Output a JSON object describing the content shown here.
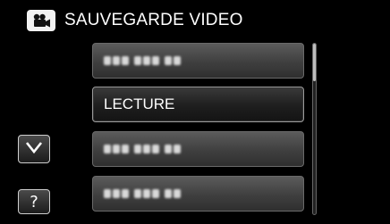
{
  "header": {
    "icon": "video-camera-icon",
    "title": "SAUVEGARDE VIDEO"
  },
  "menu": {
    "items": [
      {
        "label": "",
        "blurred": true
      },
      {
        "label": "LECTURE",
        "blurred": false,
        "selected": true
      },
      {
        "label": "",
        "blurred": true
      },
      {
        "label": "",
        "blurred": true
      }
    ]
  },
  "controls": {
    "down_icon": "chevron-down-icon",
    "help_label": "?"
  },
  "colors": {
    "background": "#000000",
    "item_fill": "#4a4a4a",
    "selected_fill": "#1e1e1e",
    "text": "#ffffff"
  }
}
